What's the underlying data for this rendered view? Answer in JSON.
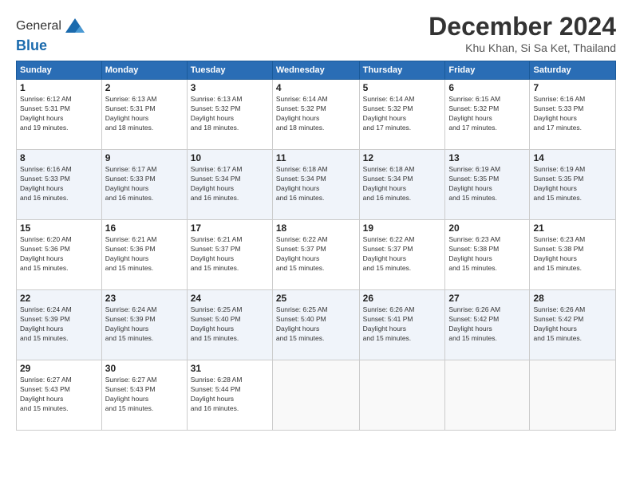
{
  "app": {
    "logo_line1": "General",
    "logo_line2": "Blue"
  },
  "header": {
    "title": "December 2024",
    "subtitle": "Khu Khan, Si Sa Ket, Thailand"
  },
  "calendar": {
    "days_of_week": [
      "Sunday",
      "Monday",
      "Tuesday",
      "Wednesday",
      "Thursday",
      "Friday",
      "Saturday"
    ],
    "weeks": [
      [
        null,
        {
          "day": "2",
          "sunrise": "6:13 AM",
          "sunset": "5:31 PM",
          "daylight": "11 hours and 18 minutes."
        },
        {
          "day": "3",
          "sunrise": "6:13 AM",
          "sunset": "5:32 PM",
          "daylight": "11 hours and 18 minutes."
        },
        {
          "day": "4",
          "sunrise": "6:14 AM",
          "sunset": "5:32 PM",
          "daylight": "11 hours and 18 minutes."
        },
        {
          "day": "5",
          "sunrise": "6:14 AM",
          "sunset": "5:32 PM",
          "daylight": "11 hours and 17 minutes."
        },
        {
          "day": "6",
          "sunrise": "6:15 AM",
          "sunset": "5:32 PM",
          "daylight": "11 hours and 17 minutes."
        },
        {
          "day": "7",
          "sunrise": "6:16 AM",
          "sunset": "5:33 PM",
          "daylight": "11 hours and 17 minutes."
        }
      ],
      [
        {
          "day": "1",
          "sunrise": "6:12 AM",
          "sunset": "5:31 PM",
          "daylight": "11 hours and 19 minutes."
        },
        {
          "day": "9",
          "sunrise": "6:17 AM",
          "sunset": "5:33 PM",
          "daylight": "11 hours and 16 minutes."
        },
        {
          "day": "10",
          "sunrise": "6:17 AM",
          "sunset": "5:34 PM",
          "daylight": "11 hours and 16 minutes."
        },
        {
          "day": "11",
          "sunrise": "6:18 AM",
          "sunset": "5:34 PM",
          "daylight": "11 hours and 16 minutes."
        },
        {
          "day": "12",
          "sunrise": "6:18 AM",
          "sunset": "5:34 PM",
          "daylight": "11 hours and 16 minutes."
        },
        {
          "day": "13",
          "sunrise": "6:19 AM",
          "sunset": "5:35 PM",
          "daylight": "11 hours and 15 minutes."
        },
        {
          "day": "14",
          "sunrise": "6:19 AM",
          "sunset": "5:35 PM",
          "daylight": "11 hours and 15 minutes."
        }
      ],
      [
        {
          "day": "8",
          "sunrise": "6:16 AM",
          "sunset": "5:33 PM",
          "daylight": "11 hours and 16 minutes."
        },
        {
          "day": "16",
          "sunrise": "6:21 AM",
          "sunset": "5:36 PM",
          "daylight": "11 hours and 15 minutes."
        },
        {
          "day": "17",
          "sunrise": "6:21 AM",
          "sunset": "5:37 PM",
          "daylight": "11 hours and 15 minutes."
        },
        {
          "day": "18",
          "sunrise": "6:22 AM",
          "sunset": "5:37 PM",
          "daylight": "11 hours and 15 minutes."
        },
        {
          "day": "19",
          "sunrise": "6:22 AM",
          "sunset": "5:37 PM",
          "daylight": "11 hours and 15 minutes."
        },
        {
          "day": "20",
          "sunrise": "6:23 AM",
          "sunset": "5:38 PM",
          "daylight": "11 hours and 15 minutes."
        },
        {
          "day": "21",
          "sunrise": "6:23 AM",
          "sunset": "5:38 PM",
          "daylight": "11 hours and 15 minutes."
        }
      ],
      [
        {
          "day": "15",
          "sunrise": "6:20 AM",
          "sunset": "5:36 PM",
          "daylight": "11 hours and 15 minutes."
        },
        {
          "day": "23",
          "sunrise": "6:24 AM",
          "sunset": "5:39 PM",
          "daylight": "11 hours and 15 minutes."
        },
        {
          "day": "24",
          "sunrise": "6:25 AM",
          "sunset": "5:40 PM",
          "daylight": "11 hours and 15 minutes."
        },
        {
          "day": "25",
          "sunrise": "6:25 AM",
          "sunset": "5:40 PM",
          "daylight": "11 hours and 15 minutes."
        },
        {
          "day": "26",
          "sunrise": "6:26 AM",
          "sunset": "5:41 PM",
          "daylight": "11 hours and 15 minutes."
        },
        {
          "day": "27",
          "sunrise": "6:26 AM",
          "sunset": "5:42 PM",
          "daylight": "11 hours and 15 minutes."
        },
        {
          "day": "28",
          "sunrise": "6:26 AM",
          "sunset": "5:42 PM",
          "daylight": "11 hours and 15 minutes."
        }
      ],
      [
        {
          "day": "22",
          "sunrise": "6:24 AM",
          "sunset": "5:39 PM",
          "daylight": "11 hours and 15 minutes."
        },
        {
          "day": "30",
          "sunrise": "6:27 AM",
          "sunset": "5:43 PM",
          "daylight": "11 hours and 15 minutes."
        },
        {
          "day": "31",
          "sunrise": "6:28 AM",
          "sunset": "5:44 PM",
          "daylight": "11 hours and 16 minutes."
        },
        null,
        null,
        null,
        null
      ],
      [
        {
          "day": "29",
          "sunrise": "6:27 AM",
          "sunset": "5:43 PM",
          "daylight": "11 hours and 15 minutes."
        },
        null,
        null,
        null,
        null,
        null,
        null
      ]
    ]
  }
}
